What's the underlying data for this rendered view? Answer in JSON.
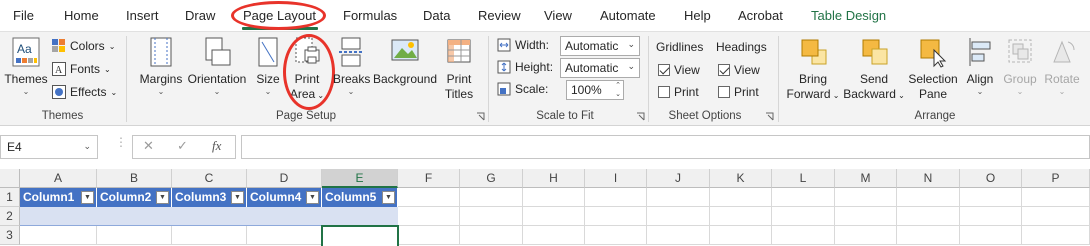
{
  "menu": {
    "tabs": [
      "File",
      "Home",
      "Insert",
      "Draw",
      "Page Layout",
      "Formulas",
      "Data",
      "Review",
      "View",
      "Automate",
      "Help",
      "Acrobat",
      "Table Design"
    ],
    "active": "Page Layout"
  },
  "ribbon": {
    "themes": {
      "label": "Themes",
      "themes_btn": "Themes",
      "colors": "Colors",
      "fonts": "Fonts",
      "effects": "Effects",
      "aa_glyph": "Aa"
    },
    "page_setup": {
      "label": "Page Setup",
      "margins": "Margins",
      "orientation": "Orientation",
      "size": "Size",
      "print_area_1": "Print",
      "print_area_2": "Area",
      "breaks": "Breaks",
      "background": "Background",
      "print_titles_1": "Print",
      "print_titles_2": "Titles"
    },
    "scale_to_fit": {
      "label": "Scale to Fit",
      "width_label": "Width:",
      "width_value": "Automatic",
      "height_label": "Height:",
      "height_value": "Automatic",
      "scale_label": "Scale:",
      "scale_value": "100%"
    },
    "sheet_options": {
      "label": "Sheet Options",
      "gridlines": "Gridlines",
      "headings": "Headings",
      "view": "View",
      "print": "Print",
      "gridlines_view": true,
      "gridlines_print": false,
      "headings_view": true,
      "headings_print": false
    },
    "arrange": {
      "label": "Arrange",
      "bring_forward_1": "Bring",
      "bring_forward_2": "Forward",
      "send_backward_1": "Send",
      "send_backward_2": "Backward",
      "selection_pane_1": "Selection",
      "selection_pane_2": "Pane",
      "align": "Align",
      "group": "Group",
      "rotate": "Rotate"
    }
  },
  "formula_bar": {
    "name_box": "E4",
    "fx": "fx",
    "cancel": "✕",
    "enter": "✓",
    "formula": ""
  },
  "grid": {
    "columns": [
      "A",
      "B",
      "C",
      "D",
      "E",
      "F",
      "G",
      "H",
      "I",
      "J",
      "K",
      "L",
      "M",
      "N",
      "O",
      "P"
    ],
    "rows": [
      "1",
      "2",
      "3"
    ],
    "selected_column": "E",
    "table_headers": [
      "Column1",
      "Column2",
      "Column3",
      "Column4",
      "Column5"
    ]
  },
  "colors": {
    "accent": "#217346",
    "table_header": "#4472c4",
    "table_band": "#d9e1f2",
    "annotation": "#e8332a"
  }
}
